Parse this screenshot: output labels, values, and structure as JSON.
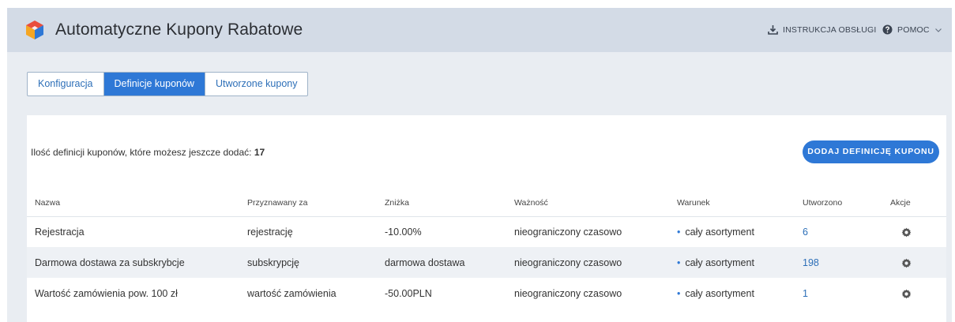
{
  "header": {
    "title": "Automatyczne Kupony Rabatowe",
    "manual_label": "INSTRUKCJA OBSŁUGI",
    "help_label": "POMOC"
  },
  "tabs": [
    {
      "label": "Konfiguracja",
      "active": false
    },
    {
      "label": "Definicje kuponów",
      "active": true
    },
    {
      "label": "Utworzone kupony",
      "active": false
    }
  ],
  "info": {
    "text": "Ilość definicji kuponów, które możesz jeszcze dodać:",
    "count": "17"
  },
  "add_button_label": "DODAJ DEFINICJĘ KUPONU",
  "table": {
    "columns": [
      "Nazwa",
      "Przyznawany za",
      "Zniżka",
      "Ważność",
      "Warunek",
      "Utworzono",
      "Akcje"
    ],
    "rows": [
      {
        "name": "Rejestracja",
        "awarded_for": "rejestrację",
        "discount": "-10.00%",
        "validity": "nieograniczony czasowo",
        "condition": "cały asortyment",
        "created": "6"
      },
      {
        "name": "Darmowa dostawa za subskrybcje",
        "awarded_for": "subskrypcję",
        "discount": "darmowa dostawa",
        "validity": "nieograniczony czasowo",
        "condition": "cały asortyment",
        "created": "198"
      },
      {
        "name": "Wartość zamówienia pow. 100 zł",
        "awarded_for": "wartość zamówienia",
        "discount": "-50.00PLN",
        "validity": "nieograniczony czasowo",
        "condition": "cały asortyment",
        "created": "1"
      }
    ]
  },
  "icons": {
    "logo": "app-logo-icon",
    "manual": "download-icon",
    "help": "question-circle-icon",
    "help_chevron": "chevron-down-icon",
    "row_action": "gear-icon",
    "condition_bullet": "bullet-icon"
  },
  "colors": {
    "accent": "#2e78d6",
    "header_bg": "#d3dbe6",
    "page_bg": "#e9edf2",
    "alt_row_bg": "#eef1f5"
  }
}
